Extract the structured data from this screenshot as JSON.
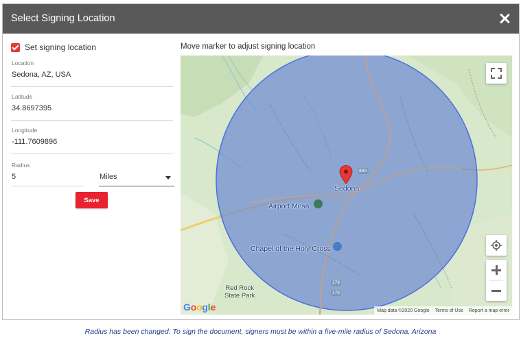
{
  "dialog": {
    "title": "Select Signing Location",
    "close_icon": "close-icon"
  },
  "form": {
    "set_location_label": "Set signing location",
    "set_location_checked": true,
    "location": {
      "label": "Location",
      "value": "Sedona, AZ, USA"
    },
    "latitude": {
      "label": "Latitude",
      "value": "34.8697395"
    },
    "longitude": {
      "label": "Longitude",
      "value": "-111.7609896"
    },
    "radius": {
      "label": "Radius",
      "value": "5",
      "unit": "Miles"
    },
    "save_label": "Save"
  },
  "map": {
    "instruction": "Move marker to adjust signing location",
    "places": {
      "sedona": "Sedona",
      "airport_mesa": "Airport Mesa",
      "chapel": "Chapel of the Holy Cross",
      "red_rock_1": "Red Rock",
      "red_rock_2": "State Park"
    },
    "routes": [
      "89A",
      "179",
      "179"
    ],
    "logo": "Google",
    "attribution": {
      "data": "Map data ©2020 Google",
      "terms": "Terms of Use",
      "report": "Report a map error"
    },
    "colors": {
      "radius_fill": "#6f8bd3",
      "radius_stroke": "#4c6fe0",
      "marker": "#e53935",
      "terrain": "#d7e8cb"
    }
  },
  "caption": "Radius has been changed: To sign the document, signers must be within a five-mile radius of Sedona, Arizona"
}
